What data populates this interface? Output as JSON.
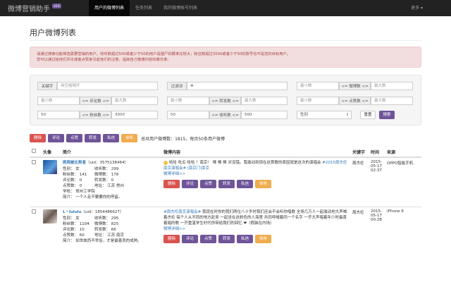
{
  "navbar": {
    "brand": "微博营销助手",
    "brand_badge": "v8.8",
    "items": [
      "用户的微博列表",
      "任务列表",
      "我的微博账号列表"
    ],
    "right_menu": "更多 ▾"
  },
  "page_title": "用户微博列表",
  "alert": {
    "line1": "请通过搜索功能筛选需要营销的用户。收听数超过500或者少于50的用户是僵尸的概率比较大，粉丝数超过3000或者少于50的账号也不是您的目标用户。",
    "line2": "您可以通过给他们评论或者点赞来引起他们的注意，提高自己微博内容的曝光率。"
  },
  "filter": {
    "keyword_label": "关键字",
    "keyword_placeholder": "用空格隔开",
    "filter_word_label": "过滤词",
    "filter_word_value": "⊗",
    "min_placeholder": "最小数",
    "max_placeholder": "最大数",
    "weibo_count_label": "<= 微博数 <=",
    "comment_count_label": "<= 评论数 <=",
    "forward_count_label": "<= 转发数 <=",
    "like_count_label": "<= 点赞数 <=",
    "fans_label": "<= 粉丝数 <=",
    "fans_min": "50",
    "fans_max": "3000",
    "follow_label": "<= 收听数 <=",
    "follow_min": "50",
    "follow_max": "500",
    "gender_select": "性别",
    "reset_button": "重置",
    "search_button": "搜索"
  },
  "toolbar": {
    "buttons": [
      "删除",
      "评论",
      "点赞",
      "转发",
      "私信",
      "收听"
    ],
    "summary": "总共用户微博数：1815，每页50条用户微博"
  },
  "table": {
    "headers": [
      "",
      "头像",
      "简介",
      "微博内容",
      "关键字",
      "时间",
      "来源"
    ],
    "row_buttons": [
      "删除",
      "评论",
      "点赞",
      "转发",
      "私信",
      "收听"
    ],
    "rows": [
      {
        "name": "闹闹被比剪者",
        "uid": "（uid：3575138464）",
        "gender": "性别：  女",
        "follows": "收听数：  299",
        "fans": "粉丝数：  141",
        "weibos": "微博数：  178",
        "comments": "评论数：  0",
        "forwards": "转发数：  0",
        "likes": "点赞数：  0",
        "location": "地址：  江苏 常州",
        "school": "学校：  常州工学院",
        "bio": "简介：  一个人走不要要你的停留。",
        "content_text": "哈哈 吃瓜 哈哈 ！南京！ 棒 棒 棒 对没错。我激动到现在这首歌的原因就是这次的演唱会",
        "content_link": "#2015周杰伦南京演唱会# |南京门|南京",
        "more_link": "微博详细>>",
        "keyword": "周杰伦",
        "time": "2015-05-17 02:37",
        "source": "OPPO智能手机"
      },
      {
        "name": "L丶lululu",
        "uid": "（uid：1854486627）",
        "gender": "性别：  女",
        "follows": "收听数：  295",
        "fans": "粉丝数：  1104",
        "weibos": "微博数：  825",
        "comments": "评论数：  10",
        "forwards": "转发数：  66",
        "likes": "点赞数：  60",
        "location": "地址：  江苏 南京",
        "school": "",
        "bio": "简介：  如世故而不世俗，才是最善良的成熟。",
        "content_link": "#周杰伦南京演唱会#",
        "content_text": "我现在时你的我们两位八十岁时我们还会不会听你唱歌 全场几万人一起激动地大声喊着杰伦 每个人从不同的地方赶来 一起坐在这粉色的人海里 共同呼喊着同一个名字 一齐大声唱着年少时最喜着唱的歌 一齐重温学生时代你带给我们的回忆 ❤（假装在内场）",
        "more_link": "微博详细>>",
        "keyword": "周杰伦",
        "time": "2015-05-17 00:28",
        "source": "iPhone 6"
      }
    ]
  },
  "colors": {
    "navbar_bg": "#222222",
    "accent_purple": "#6f5499",
    "danger_red": "#d9534f",
    "warning_orange": "#f0ad4e",
    "alert_bg": "#f2dede",
    "link_blue": "#337ab7"
  }
}
